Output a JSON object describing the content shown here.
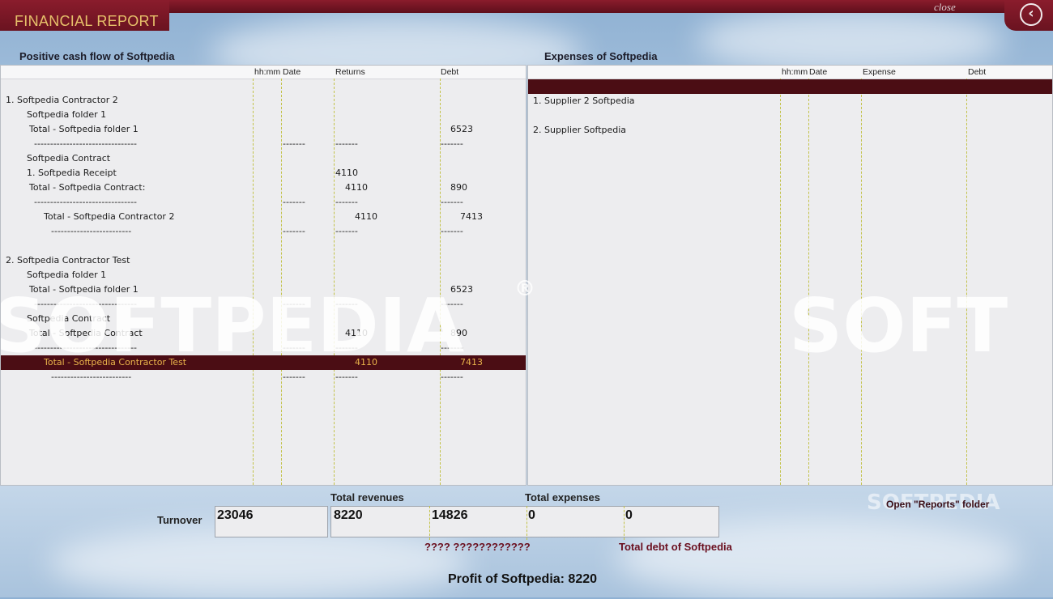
{
  "app": {
    "title": "FINANCIAL REPORT",
    "close_label": "close",
    "back_icon": "chevron-left-icon"
  },
  "left": {
    "title": "Positive cash flow of Softpedia",
    "columns": [
      "hh:mm",
      "Date",
      "Returns",
      "Debt"
    ],
    "rows": [
      {
        "name": "1. Softpedia Contractor 2",
        "date": "",
        "returns": "",
        "debt": "",
        "indent": 0
      },
      {
        "name": "Softpedia folder 1",
        "date": "",
        "returns": "",
        "debt": "",
        "indent": 1
      },
      {
        "name": "Total - Softpedia folder 1",
        "date": "",
        "returns": "",
        "debt": "6523",
        "indent": 2
      },
      {
        "name": "--------------------------------",
        "date": "-------",
        "returns": "-------",
        "debt": "-------",
        "indent": 3
      },
      {
        "name": "Softpedia Contract",
        "date": "",
        "returns": "",
        "debt": "",
        "indent": 1
      },
      {
        "name": "1. Softpedia Receipt",
        "date": "",
        "returns": "4110",
        "debt": "",
        "indent": 4
      },
      {
        "name": "Total - Softpedia Contract:",
        "date": "",
        "returns": "4110",
        "debt": "890",
        "indent": 2
      },
      {
        "name": "--------------------------------",
        "date": "-------",
        "returns": "-------",
        "debt": "-------",
        "indent": 3
      },
      {
        "name": "Total - Softpedia Contractor 2",
        "date": "",
        "returns": "4110",
        "debt": "7413",
        "indent": 5
      },
      {
        "name": "-------------------------",
        "date": "-------",
        "returns": "-------",
        "debt": "-------",
        "indent": 6
      },
      {
        "name": "",
        "date": "",
        "returns": "",
        "debt": "",
        "indent": 0
      },
      {
        "name": "2. Softpedia Contractor Test",
        "date": "",
        "returns": "",
        "debt": "",
        "indent": 0
      },
      {
        "name": "Softpedia folder 1",
        "date": "",
        "returns": "",
        "debt": "",
        "indent": 1
      },
      {
        "name": "Total - Softpedia folder 1",
        "date": "",
        "returns": "",
        "debt": "6523",
        "indent": 2
      },
      {
        "name": "--------------------------------",
        "date": "-------",
        "returns": "-------",
        "debt": "-------",
        "indent": 3
      },
      {
        "name": "Softpedia Contract",
        "date": "",
        "returns": "",
        "debt": "",
        "indent": 1
      },
      {
        "name": "Total - Softpedia Contract",
        "date": "",
        "returns": "4110",
        "debt": "890",
        "indent": 2
      },
      {
        "name": "--------------------------------",
        "date": "-------",
        "returns": "-------",
        "debt": "-------",
        "indent": 3
      },
      {
        "name": "Total - Softpedia Contractor Test",
        "date": "",
        "returns": "4110",
        "debt": "7413",
        "indent": 5,
        "selected": true
      },
      {
        "name": "-------------------------",
        "date": "-------",
        "returns": "-------",
        "debt": "-------",
        "indent": 6
      }
    ]
  },
  "right": {
    "title": "Expenses of Softpedia",
    "columns": [
      "hh:mm",
      "Date",
      "Expense",
      "Debt"
    ],
    "rows": [
      {
        "name": "",
        "selected": true
      },
      {
        "name": "1. Supplier 2 Softpedia"
      },
      {
        "name": ""
      },
      {
        "name": "2. Supplier Softpedia"
      }
    ]
  },
  "summary": {
    "turnover_label": "Turnover",
    "total_revenues_label": "Total revenues",
    "total_expenses_label": "Total expenses",
    "turnover_value": "23046",
    "revenues_value": "8220",
    "revenues_value2": "14826",
    "expenses_value": "0",
    "debt_value": "0",
    "garbled_label": "???? ????????????",
    "total_debt_label": "Total debt of Softpedia",
    "profit_text": "Profit of Softpedia: 8220",
    "open_folder_label": "Open \"Reports\" folder"
  },
  "watermarks": {
    "left": "SOFTPEDIA",
    "right": "SOFT",
    "corner": "SOFTPEDIA",
    "reg_mark": "®"
  },
  "colors": {
    "maroon": "#6a1320",
    "gold": "#e6c06a",
    "highlight": "#4b0d14"
  }
}
